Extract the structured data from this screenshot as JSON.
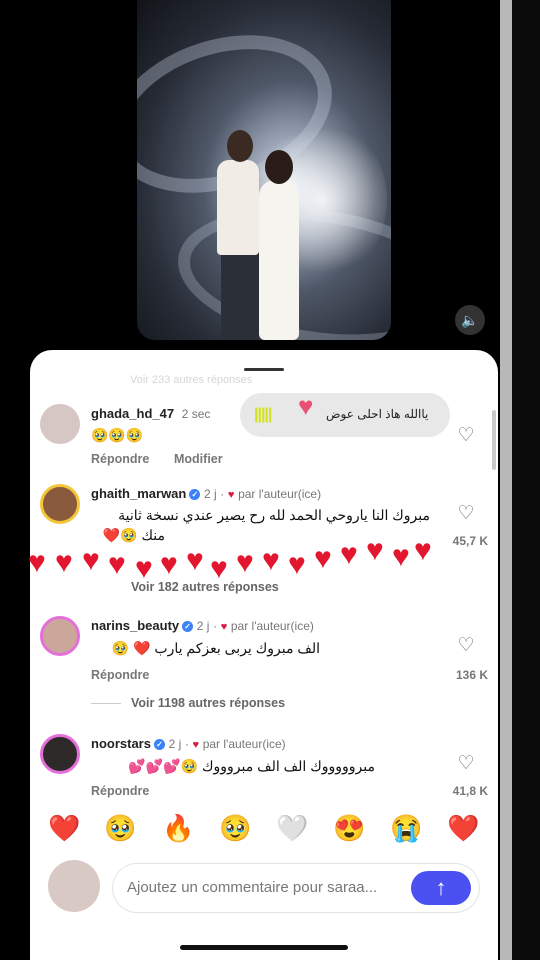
{
  "video": {
    "mute_icon": "speaker-icon"
  },
  "sheet": {
    "faded_header": "Voir 233 autres réponses",
    "sticker": {
      "text": "ياالله هاذ احلى عوض"
    },
    "comments": [
      {
        "username": "ghada_hd_47",
        "time": "2 sec",
        "text": "🥹🥹🥹",
        "reply": "Répondre",
        "edit": "Modifier"
      },
      {
        "username": "ghaith_marwan",
        "time": "2 j",
        "author_badge": "par l'auteur(ice)",
        "text_line1": "مبروك النا ياروحي الحمد لله رح يصير عندي نسخة ثانية",
        "text_line2": "منك 🥹❤️",
        "likes": "45,7 K",
        "see_more": "Voir 182 autres réponses"
      },
      {
        "username": "narins_beauty",
        "time": "2 j",
        "author_badge": "par l'auteur(ice)",
        "text": "الف مبروك يربى بعزكم يارب ❤️ 🥹",
        "reply": "Répondre",
        "likes": "136 K",
        "see_more": "Voir 1198 autres réponses"
      },
      {
        "username": "noorstars",
        "time": "2 j",
        "author_badge": "par l'auteur(ice)",
        "text": "مبروووووك الف الف مبروووك 🥹💕💕💕",
        "reply": "Répondre",
        "likes": "41,8 K"
      }
    ],
    "emoji_bar": [
      "❤️",
      "🥹",
      "🔥",
      "🥹",
      "🤍",
      "😍",
      "😭",
      "❤️"
    ],
    "input": {
      "placeholder": "Ajoutez un commentaire pour saraa..."
    }
  }
}
